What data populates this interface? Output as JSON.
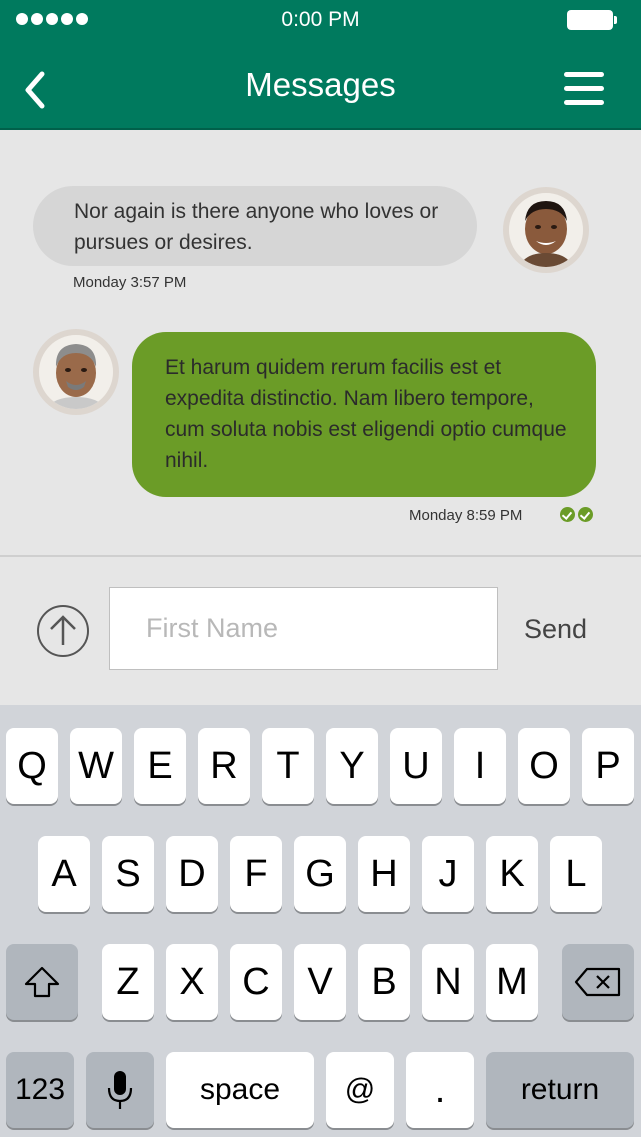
{
  "status_bar": {
    "time": "0:00 PM"
  },
  "header": {
    "title": "Messages"
  },
  "messages": [
    {
      "text": "Nor again is there anyone who loves or pursues or desires.",
      "timestamp": "Monday 3:57 PM"
    },
    {
      "text": "Et harum quidem rerum facilis est et expedita distinctio. Nam libero tempore, cum soluta nobis est eligendi optio cumque nihil.",
      "timestamp": "Monday 8:59 PM"
    }
  ],
  "composer": {
    "placeholder": "First Name",
    "value": "",
    "send_label": "Send"
  },
  "keyboard": {
    "row1": [
      "Q",
      "W",
      "E",
      "R",
      "T",
      "Y",
      "U",
      "I",
      "O",
      "P"
    ],
    "row2": [
      "A",
      "S",
      "D",
      "F",
      "G",
      "H",
      "J",
      "K",
      "L"
    ],
    "row3": [
      "Z",
      "X",
      "C",
      "V",
      "B",
      "N",
      "M"
    ],
    "numbers_label": "123",
    "space_label": "space",
    "at_label": "@",
    "period_label": ".",
    "return_label": "return"
  },
  "colors": {
    "header": "#007a5e",
    "outgoing_bubble": "#6b9c27",
    "incoming_bubble": "#d6d6d6"
  }
}
